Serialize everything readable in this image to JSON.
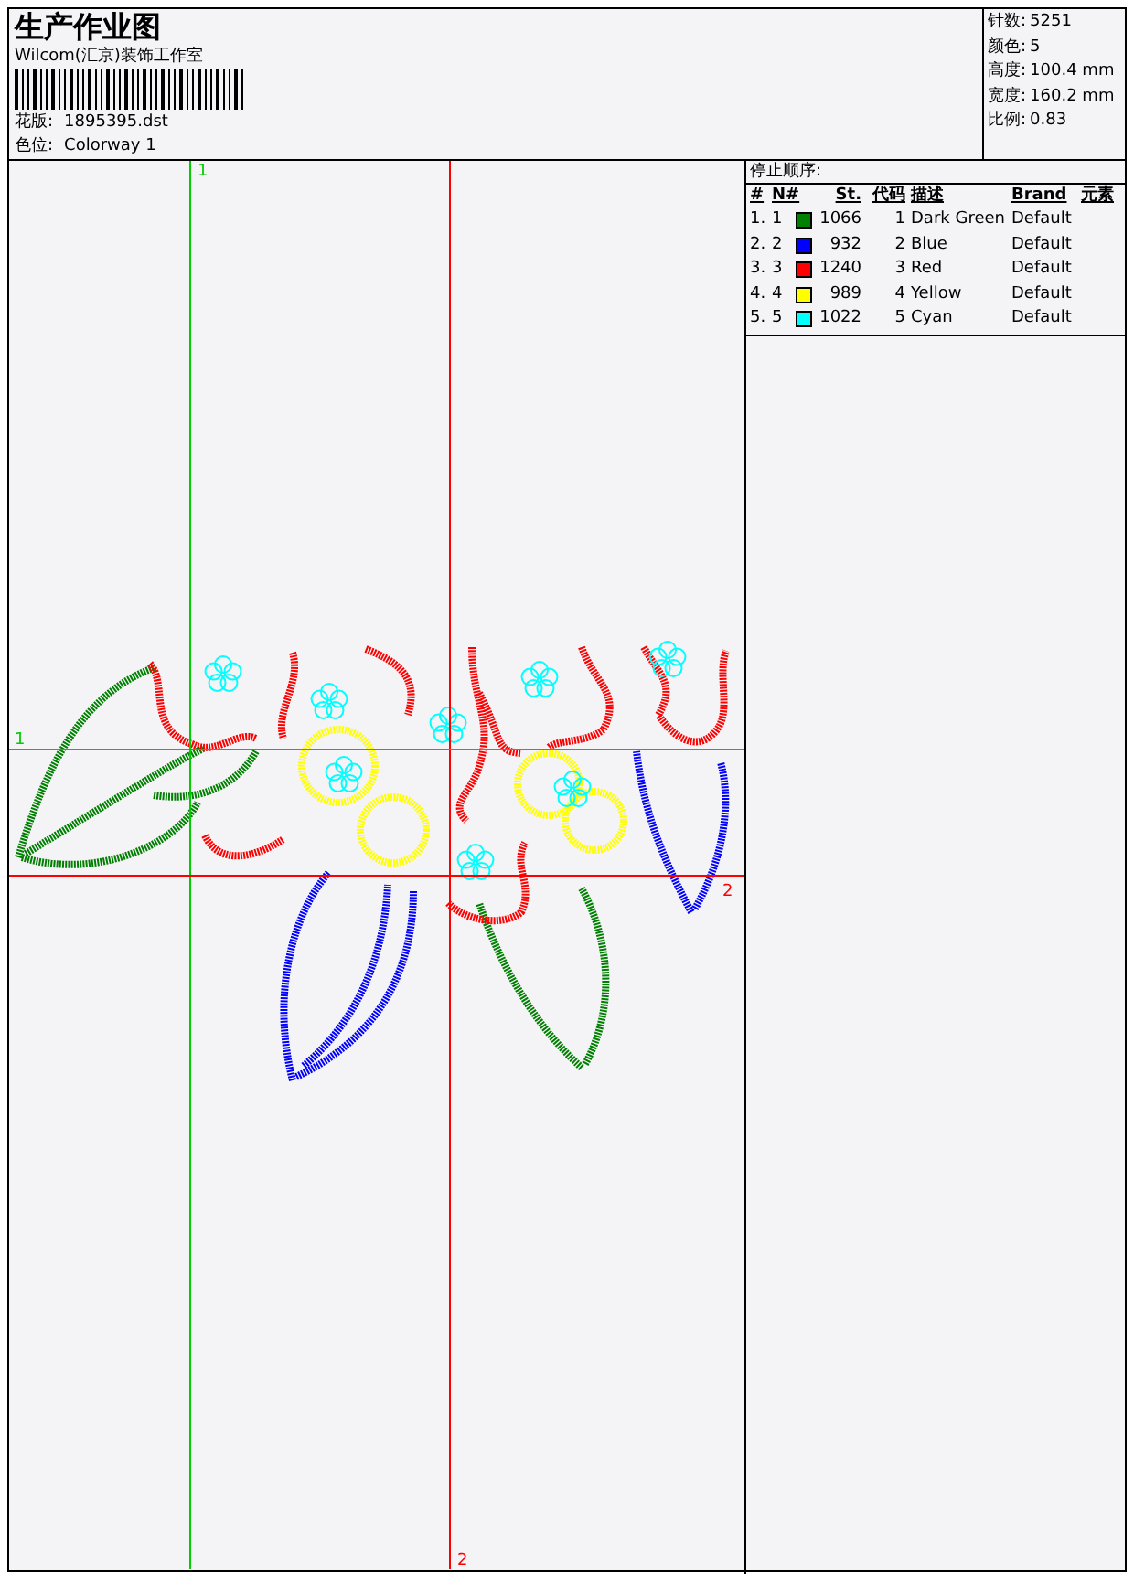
{
  "header": {
    "title": "生产作业图",
    "company": "Wilcom(汇京)装饰工作室",
    "design_label": "花版:",
    "design": "1895395.dst",
    "colorway_label": "色位:",
    "colorway": "Colorway 1"
  },
  "stats": [
    {
      "label": "针数:",
      "value": "5251"
    },
    {
      "label": "颜色:",
      "value": "5"
    },
    {
      "label": "高度:",
      "value": "100.4 mm"
    },
    {
      "label": "宽度:",
      "value": "160.2 mm"
    },
    {
      "label": "比例:",
      "value": "0.83"
    }
  ],
  "stop_sequence": {
    "title": "停止顺序:",
    "columns": [
      "#",
      "N#",
      "St.",
      "代码",
      "描述",
      "Brand",
      "元素"
    ],
    "rows": [
      {
        "index": "1.",
        "needle": "1",
        "color": "#008000",
        "stitches": "1066",
        "code": "1",
        "description": "Dark Green",
        "brand": "Default"
      },
      {
        "index": "2.",
        "needle": "2",
        "color": "#0000ff",
        "stitches": "932",
        "code": "2",
        "description": "Blue",
        "brand": "Default"
      },
      {
        "index": "3.",
        "needle": "3",
        "color": "#ff0000",
        "stitches": "1240",
        "code": "3",
        "description": "Red",
        "brand": "Default"
      },
      {
        "index": "4.",
        "needle": "4",
        "color": "#ffff00",
        "stitches": "989",
        "code": "4",
        "description": "Yellow",
        "brand": "Default"
      },
      {
        "index": "5.",
        "needle": "5",
        "color": "#00ffff",
        "stitches": "1022",
        "code": "5",
        "description": "Cyan",
        "brand": "Default"
      }
    ]
  },
  "vertical_guides": [
    {
      "color": "#00cc00",
      "label": "1"
    },
    {
      "color": "#ff0000",
      "label": "2"
    }
  ],
  "horizontal_guides": [
    {
      "color": "#00cc00",
      "label": "1"
    },
    {
      "color": "#ff0000",
      "label": "2"
    }
  ]
}
